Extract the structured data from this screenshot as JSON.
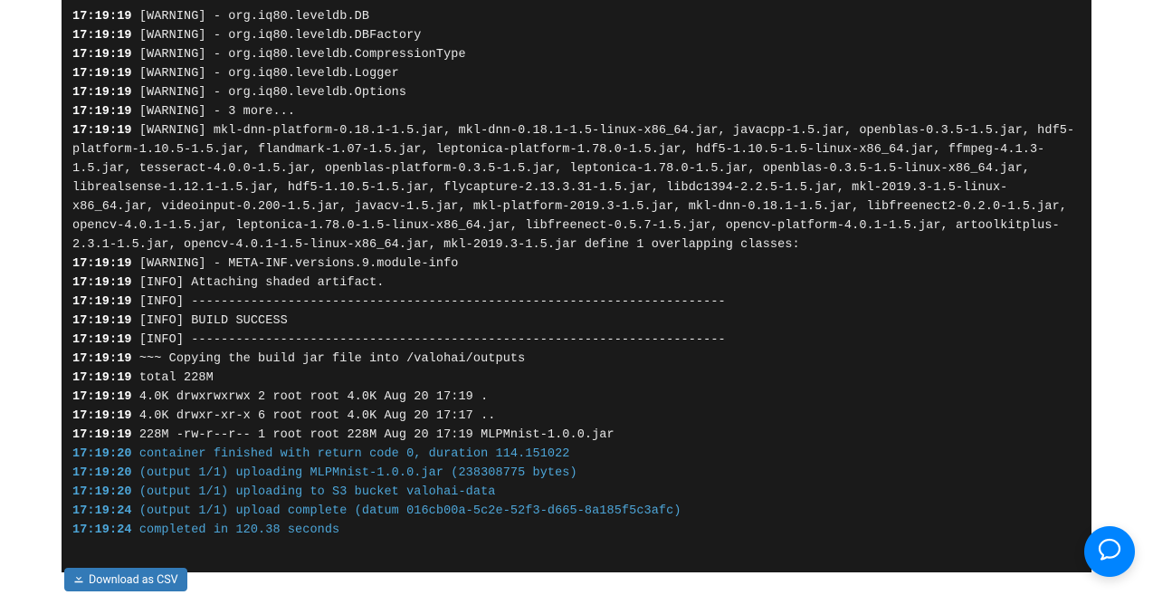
{
  "logs": [
    {
      "ts": "17:19:19",
      "msg": "[WARNING] - org.iq80.leveldb.DB",
      "style": "w"
    },
    {
      "ts": "17:19:19",
      "msg": "[WARNING] - org.iq80.leveldb.DBFactory",
      "style": "w"
    },
    {
      "ts": "17:19:19",
      "msg": "[WARNING] - org.iq80.leveldb.CompressionType",
      "style": "w"
    },
    {
      "ts": "17:19:19",
      "msg": "[WARNING] - org.iq80.leveldb.Logger",
      "style": "w"
    },
    {
      "ts": "17:19:19",
      "msg": "[WARNING] - org.iq80.leveldb.Options",
      "style": "w"
    },
    {
      "ts": "17:19:19",
      "msg": "[WARNING] - 3 more...",
      "style": "w"
    },
    {
      "ts": "17:19:19",
      "msg": "[WARNING] mkl-dnn-platform-0.18.1-1.5.jar, mkl-dnn-0.18.1-1.5-linux-x86_64.jar, javacpp-1.5.jar, openblas-0.3.5-1.5.jar, hdf5-platform-1.10.5-1.5.jar, flandmark-1.07-1.5.jar, leptonica-platform-1.78.0-1.5.jar, hdf5-1.10.5-1.5-linux-x86_64.jar, ffmpeg-4.1.3-1.5.jar, tesseract-4.0.0-1.5.jar, openblas-platform-0.3.5-1.5.jar, leptonica-1.78.0-1.5.jar, openblas-0.3.5-1.5-linux-x86_64.jar, librealsense-1.12.1-1.5.jar, hdf5-1.10.5-1.5.jar, flycapture-2.13.3.31-1.5.jar, libdc1394-2.2.5-1.5.jar, mkl-2019.3-1.5-linux-x86_64.jar, videoinput-0.200-1.5.jar, javacv-1.5.jar, mkl-platform-2019.3-1.5.jar, mkl-dnn-0.18.1-1.5.jar, libfreenect2-0.2.0-1.5.jar, opencv-4.0.1-1.5.jar, leptonica-1.78.0-1.5-linux-x86_64.jar, libfreenect-0.5.7-1.5.jar, opencv-platform-4.0.1-1.5.jar, artoolkitplus-2.3.1-1.5.jar, opencv-4.0.1-1.5-linux-x86_64.jar, mkl-2019.3-1.5.jar define 1 overlapping classes:",
      "style": "w"
    },
    {
      "ts": "17:19:19",
      "msg": "[WARNING] - META-INF.versions.9.module-info",
      "style": "w"
    },
    {
      "ts": "17:19:19",
      "msg": "[INFO] Attaching shaded artifact.",
      "style": "w"
    },
    {
      "ts": "17:19:19",
      "msg": "[INFO] ------------------------------------------------------------------------",
      "style": "w"
    },
    {
      "ts": "17:19:19",
      "msg": "[INFO] BUILD SUCCESS",
      "style": "w"
    },
    {
      "ts": "17:19:19",
      "msg": "[INFO] ------------------------------------------------------------------------",
      "style": "w"
    },
    {
      "ts": "17:19:19",
      "msg": "~~~ Copying the build jar file into /valohai/outputs",
      "style": "w"
    },
    {
      "ts": "17:19:19",
      "msg": "total 228M",
      "style": "w"
    },
    {
      "ts": "17:19:19",
      "msg": "4.0K drwxrwxrwx 2 root root 4.0K Aug 20 17:19 .",
      "style": "w"
    },
    {
      "ts": "17:19:19",
      "msg": "4.0K drwxr-xr-x 6 root root 4.0K Aug 20 17:17 ..",
      "style": "w"
    },
    {
      "ts": "17:19:19",
      "msg": "228M -rw-r--r-- 1 root root 228M Aug 20 17:19 MLPMnist-1.0.0.jar",
      "style": "w"
    },
    {
      "ts": "17:19:20",
      "msg": "container finished with return code 0, duration 114.151022",
      "style": "b"
    },
    {
      "ts": "17:19:20",
      "msg": "(output 1/1) uploading MLPMnist-1.0.0.jar (238308775 bytes)",
      "style": "b"
    },
    {
      "ts": "17:19:20",
      "msg": "(output 1/1) uploading to S3 bucket valohai-data",
      "style": "b"
    },
    {
      "ts": "17:19:24",
      "msg": "(output 1/1) upload complete (datum 016cb00a-5c2e-52f3-d665-8a185f5c3afc)",
      "style": "b"
    },
    {
      "ts": "17:19:24",
      "msg": "completed in 120.38 seconds",
      "style": "b"
    }
  ],
  "download_label": "Download as CSV"
}
